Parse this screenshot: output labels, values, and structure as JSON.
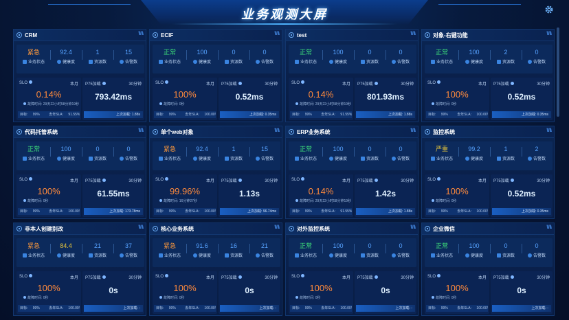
{
  "title": "业务观测大屏",
  "labels": {
    "status": "业务状态",
    "health": "健康度",
    "resources": "资源数",
    "alerts": "告警数",
    "slo": "SLO",
    "month": "本月",
    "p75": "P75加载",
    "window": "30分钟",
    "target": "目标:",
    "yoy": "去年SLA:",
    "last": "上次加载:"
  },
  "cards": [
    {
      "name": "CRM",
      "status": "紧急",
      "status_color": "orange",
      "health": "92.4",
      "health_color": "blue",
      "res": "1",
      "alerts": "15",
      "slo": "0.14%",
      "slo_note": "故障时间: 29天22小时58分钟19秒",
      "target": "99%",
      "yoy": "91.55%",
      "p75": "793.42ms",
      "last": "1.88s"
    },
    {
      "name": "ECIF",
      "status": "正常",
      "status_color": "green",
      "health": "100",
      "health_color": "blue",
      "res": "0",
      "alerts": "0",
      "slo": "100%",
      "slo_note": "故障时间: 0秒",
      "target": "99%",
      "yoy": "100.00%",
      "p75": "0.52ms",
      "last": "0.35ms"
    },
    {
      "name": "test",
      "status": "正常",
      "status_color": "green",
      "health": "100",
      "health_color": "blue",
      "res": "0",
      "alerts": "0",
      "slo": "0.14%",
      "slo_note": "故障时间: 29天22小时58分钟19秒",
      "target": "99%",
      "yoy": "91.55%",
      "p75": "801.93ms",
      "last": "1.88s"
    },
    {
      "name": "对象-右键功能",
      "status": "正常",
      "status_color": "green",
      "health": "100",
      "health_color": "blue",
      "res": "2",
      "alerts": "0",
      "slo": "100%",
      "slo_note": "故障时间: 0秒",
      "target": "99%",
      "yoy": "100.00%",
      "p75": "0.52ms",
      "last": "0.35ms"
    },
    {
      "name": "代码托管系统",
      "status": "正常",
      "status_color": "green",
      "health": "100",
      "health_color": "blue",
      "res": "0",
      "alerts": "0",
      "slo": "100%",
      "slo_note": "故障时间: 0秒",
      "target": "99%",
      "yoy": "100.00%",
      "p75": "61.55ms",
      "last": "173.78ms"
    },
    {
      "name": "单个web对象",
      "status": "紧急",
      "status_color": "orange",
      "health": "92.4",
      "health_color": "blue",
      "res": "1",
      "alerts": "15",
      "slo": "99.96%",
      "slo_note": "故障时间: 16分钟27秒",
      "target": "99%",
      "yoy": "100.00%",
      "p75": "1.13s",
      "last": "96.74ms"
    },
    {
      "name": "ERP业务系统",
      "status": "正常",
      "status_color": "green",
      "health": "100",
      "health_color": "blue",
      "res": "0",
      "alerts": "0",
      "slo": "0.14%",
      "slo_note": "故障时间: 29天22小时58分钟19秒",
      "target": "99%",
      "yoy": "91.55%",
      "p75": "1.42s",
      "last": "1.88s"
    },
    {
      "name": "监控系统",
      "status": "严重",
      "status_color": "yellow",
      "health": "99.2",
      "health_color": "blue",
      "res": "1",
      "alerts": "2",
      "slo": "100%",
      "slo_note": "故障时间: 0秒",
      "target": "99%",
      "yoy": "100.00%",
      "p75": "0.52ms",
      "last": "0.35ms"
    },
    {
      "name": "非本人创建别改",
      "status": "紧急",
      "status_color": "orange",
      "health": "84.4",
      "health_color": "yellow",
      "res": "21",
      "alerts": "37",
      "slo": "100%",
      "slo_note": "故障时间: 0秒",
      "target": "99%",
      "yoy": "100.00%",
      "p75": "0s",
      "last": "-"
    },
    {
      "name": "核心业务系统",
      "status": "紧急",
      "status_color": "orange",
      "health": "91.6",
      "health_color": "blue",
      "res": "16",
      "alerts": "21",
      "slo": "100%",
      "slo_note": "故障时间: 0秒",
      "target": "99%",
      "yoy": "100.00%",
      "p75": "0s",
      "last": "-"
    },
    {
      "name": "对外监控系统",
      "status": "正常",
      "status_color": "green",
      "health": "100",
      "health_color": "blue",
      "res": "0",
      "alerts": "0",
      "slo": "100%",
      "slo_note": "故障时间: 0秒",
      "target": "99%",
      "yoy": "100.00%",
      "p75": "0s",
      "last": "-"
    },
    {
      "name": "企业微信",
      "status": "正常",
      "status_color": "green",
      "health": "100",
      "health_color": "blue",
      "res": "0",
      "alerts": "0",
      "slo": "100%",
      "slo_note": "故障时间: 0秒",
      "target": "99%",
      "yoy": "100.00%",
      "p75": "0s",
      "last": "-"
    }
  ]
}
